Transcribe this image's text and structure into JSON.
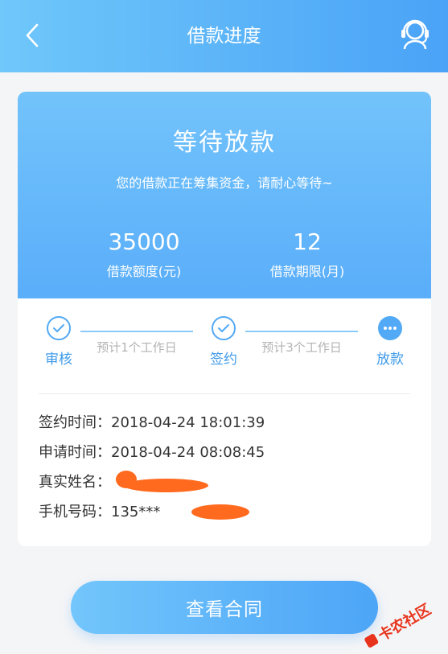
{
  "header": {
    "title": "借款进度",
    "back_icon": "chevron-left-icon",
    "service_icon": "customer-service-icon"
  },
  "status": {
    "title": "等待放款",
    "description": "您的借款正在筹集资金，请耐心等待~"
  },
  "stats": {
    "amount_value": "35000",
    "amount_label": "借款额度(元)",
    "term_value": "12",
    "term_label": "借款期限(月)"
  },
  "progress": {
    "steps": [
      {
        "label": "审核",
        "state": "done"
      },
      {
        "label": "签约",
        "state": "done"
      },
      {
        "label": "放款",
        "state": "pending"
      }
    ],
    "connectors": [
      "预计1个工作日",
      "预计3个工作日"
    ]
  },
  "info": {
    "rows": [
      "签约时间：2018-04-24 18:01:39",
      "申请时间：2018-04-24 08:08:45",
      "真实姓名：",
      "手机号码：135***"
    ]
  },
  "actions": {
    "view_contract": "查看合同"
  },
  "watermark": {
    "text": "卡农社区"
  },
  "colors": {
    "primary": "#52a9f5",
    "header_start": "#6fc7fa",
    "header_end": "#4aa3f7",
    "redaction": "#ff6a1f"
  }
}
